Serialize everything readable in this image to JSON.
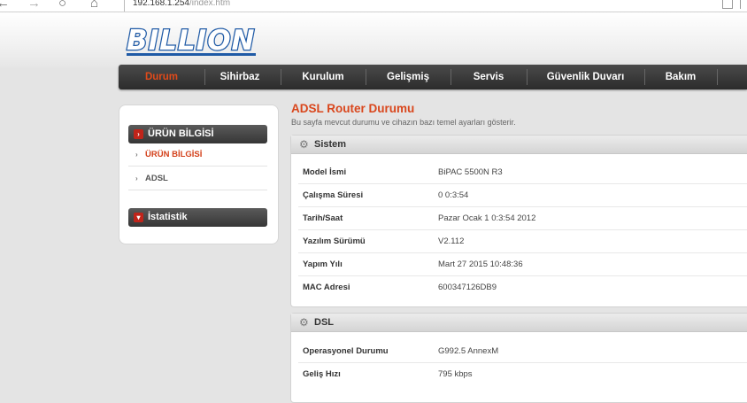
{
  "browser": {
    "url_host": "192.168.1.254",
    "url_path": "/index.htm"
  },
  "brand": {
    "logo_text": "BILLION"
  },
  "nav": {
    "items": [
      {
        "label": "Durum",
        "active": true
      },
      {
        "label": "Sihirbaz",
        "active": false
      },
      {
        "label": "Kurulum",
        "active": false
      },
      {
        "label": "Gelişmiş",
        "active": false
      },
      {
        "label": "Servis",
        "active": false
      },
      {
        "label": "Güvenlik Duvarı",
        "active": false
      },
      {
        "label": "Bakım",
        "active": false
      }
    ]
  },
  "sidebar": {
    "section1": "ÜRÜN BİLGİSİ",
    "links": [
      "ÜRÜN BİLGİSİ",
      "ADSL"
    ],
    "section2": "İstatistik"
  },
  "content": {
    "title": "ADSL Router Durumu",
    "description": "Bu sayfa mevcut durumu ve cihazın bazı temel ayarları gösterir."
  },
  "system": {
    "heading": "Sistem",
    "rows": [
      {
        "key": "Model İsmi",
        "value": "BiPAC 5500N R3"
      },
      {
        "key": "Çalışma Süresi",
        "value": "0 0:3:54"
      },
      {
        "key": "Tarih/Saat",
        "value": "Pazar Ocak 1 0:3:54 2012"
      },
      {
        "key": "Yazılım Sürümü",
        "value": "V2.112"
      },
      {
        "key": "Yapım Yılı",
        "value": "Mart 27 2015 10:48:36"
      },
      {
        "key": "MAC Adresi",
        "value": "600347126DB9"
      }
    ]
  },
  "dsl": {
    "heading": "DSL",
    "rows": [
      {
        "key": "Operasyonel Durumu",
        "value": "G992.5 AnnexM"
      },
      {
        "key": "Geliş Hızı",
        "value": "795 kbps"
      }
    ]
  },
  "colors": {
    "accent": "#d9461c",
    "nav_bg": "#333333",
    "logo_blue": "#1f5aa6"
  },
  "icons": {
    "back": "arrow-left-icon",
    "forward": "arrow-right-icon",
    "reload": "reload-icon",
    "home": "home-icon",
    "gear": "gear-icon",
    "chevron": "chevron-right-icon"
  }
}
